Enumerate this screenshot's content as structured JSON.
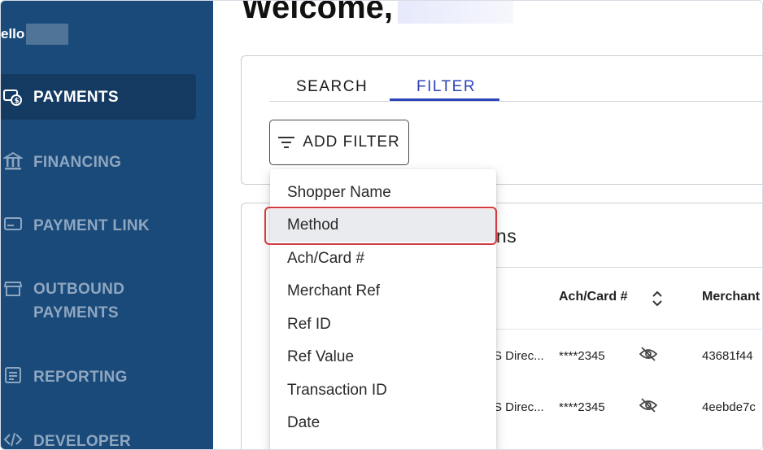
{
  "greeting": {
    "hello": "ello"
  },
  "welcome": {
    "text": "Welcome,"
  },
  "sidebar": {
    "items": [
      {
        "label": "PAYMENTS",
        "icon": "payments-icon",
        "active": true
      },
      {
        "label": "FINANCING",
        "icon": "bank-icon"
      },
      {
        "label": "PAYMENT LINK",
        "icon": "link-card-icon"
      },
      {
        "label_line1": "OUTBOUND",
        "label_line2": "PAYMENTS",
        "icon": "storefront-icon"
      },
      {
        "label": "REPORTING",
        "icon": "report-icon"
      },
      {
        "label": "DEVELOPER",
        "icon": "code-icon"
      }
    ]
  },
  "tabs": {
    "search": "SEARCH",
    "filter": "FILTER"
  },
  "add_filter": {
    "label": "ADD FILTER",
    "icon": "filter-lines-icon"
  },
  "filter_menu": {
    "items": [
      "Shopper Name",
      "Method",
      "Ach/Card #",
      "Merchant Ref",
      "Ref ID",
      "Ref Value",
      "Transaction ID",
      "Date"
    ],
    "highlighted": "Method"
  },
  "transactions": {
    "title_fragment": "ions",
    "columns": {
      "ach_card": "Ach/Card #",
      "merchant": "Merchant"
    },
    "rows": [
      {
        "method": "S Direc...",
        "card": "****2345",
        "merchant": "43681f44"
      },
      {
        "method": "S Direc...",
        "card": "****2345",
        "merchant": "4eebde7c"
      }
    ]
  },
  "colors": {
    "sidebar": "#1a4a7a",
    "accent": "#2c45b8",
    "highlight_border": "#d43b3f"
  }
}
